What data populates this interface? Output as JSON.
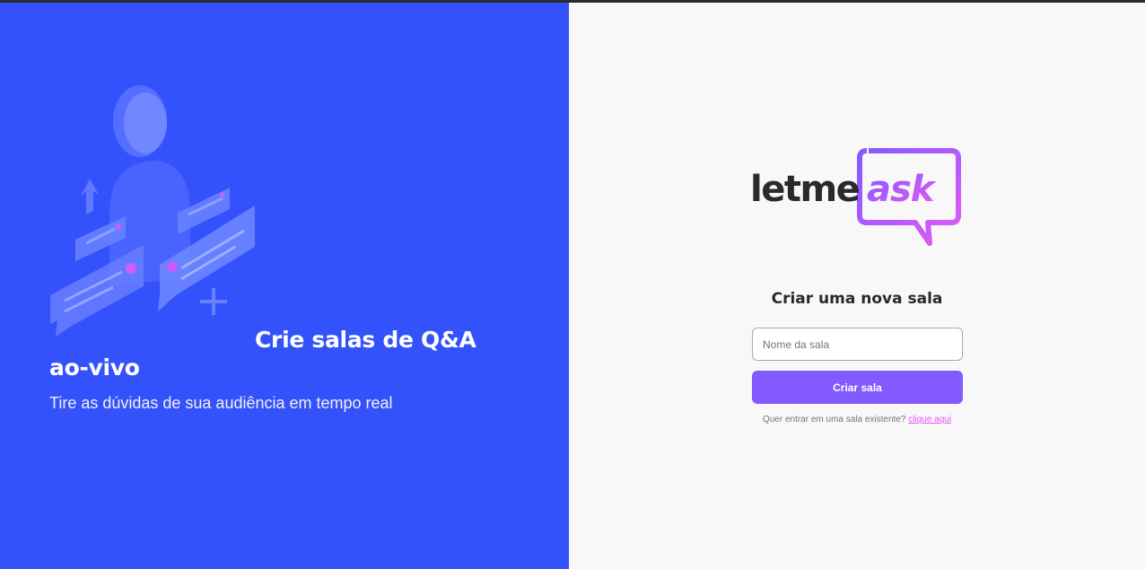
{
  "aside": {
    "title": "Crie salas de Q&A ao-vivo",
    "subtitle": "Tire as dúvidas de sua audiência em tempo real",
    "illustration": "q-and-a-illustration"
  },
  "logo": {
    "part1": "letme",
    "part2": "ask"
  },
  "main": {
    "title": "Criar uma nova sala",
    "room_input": {
      "placeholder": "Nome da sala",
      "value": ""
    },
    "create_button": "Criar sala",
    "join_prompt": "Quer entrar em uma sala existente?",
    "join_link": "clique aqui"
  },
  "colors": {
    "aside_bg": "#3452fc",
    "primary": "#835afd",
    "accent_pink": "#e559f9",
    "page_bg": "#f8f8f8",
    "text_dark": "#29292e",
    "text_muted": "#737380"
  }
}
